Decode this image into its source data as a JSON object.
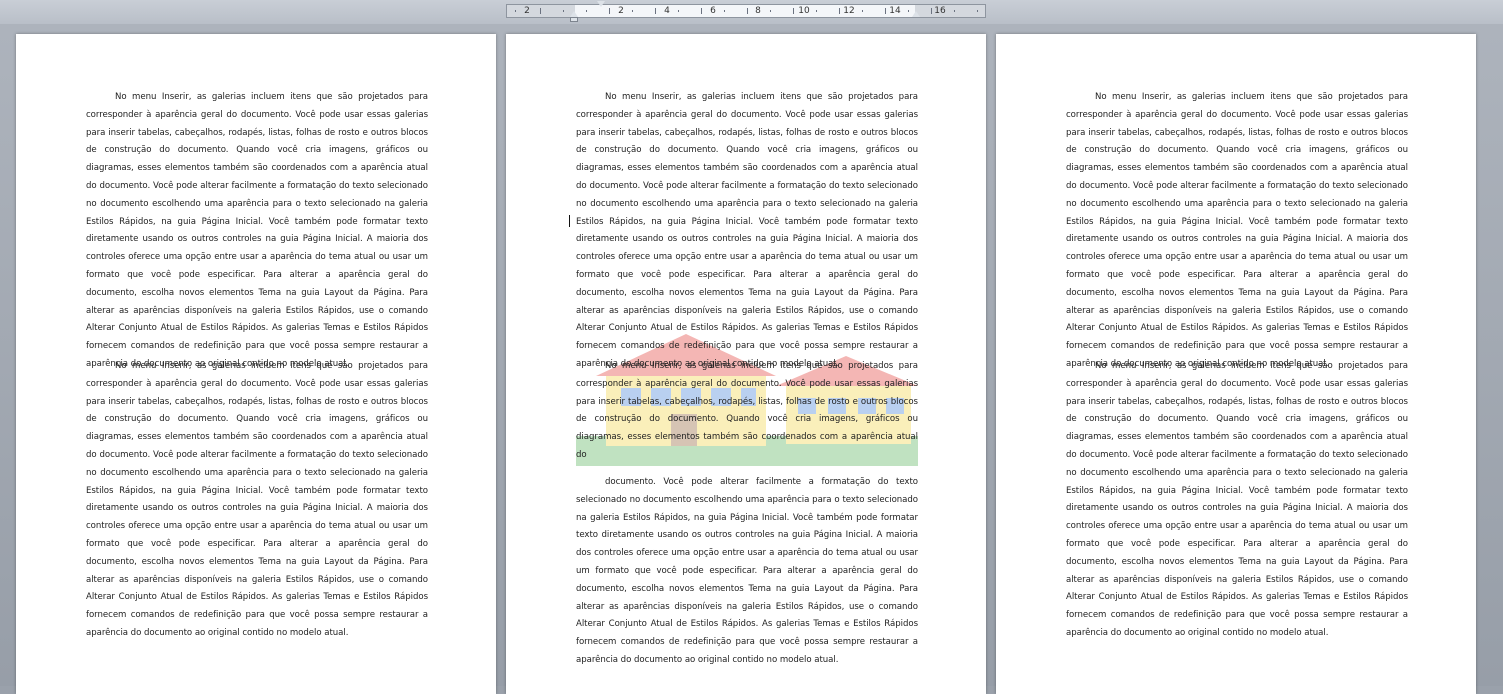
{
  "ruler": {
    "labels": [
      "2",
      "2",
      "4",
      "6",
      "8",
      "10",
      "12",
      "14",
      "16"
    ]
  },
  "document": {
    "paragraph_full": "No menu Inserir, as galerias incluem itens que são projetados para corresponder à aparência geral do documento. Você pode usar essas galerias para inserir tabelas, cabeçalhos, rodapés, listas, folhas de rosto e outros blocos de construção do documento. Quando você cria imagens, gráficos ou diagramas, esses elementos também são coordenados com a aparência atual do documento. Você pode alterar facilmente a formatação do texto selecionado no documento escolhendo uma aparência para o texto selecionado na galeria Estilos Rápidos, na guia Página Inicial. Você também pode formatar texto diretamente usando os outros controles na guia Página Inicial. A maioria dos controles oferece uma opção entre usar a aparência do tema atual ou usar um formato que você pode especificar. Para alterar a aparência geral do documento, escolha novos elementos Tema na guia Layout da Página. Para alterar as aparências disponíveis na galeria Estilos Rápidos, use o comando Alterar Conjunto Atual de Estilos Rápidos. As galerias Temas e Estilos Rápidos fornecem comandos de redefinição para que você possa sempre restaurar a aparência do documento ao original contido no modelo atual.",
    "paragraph_part1": "No menu Inserir, as galerias incluem itens que são projetados para corresponder à aparência geral do documento. Você pode usar essas galerias para inserir tabelas, cabeçalhos, rodapés, listas, folhas de rosto e outros blocos de construção do documento. Quando você cria imagens, gráficos ou diagramas, esses elementos também são coordenados com a aparência atual do",
    "paragraph_part2": "documento. Você pode alterar facilmente a formatação do texto selecionado no documento escolhendo uma aparência para o texto selecionado na galeria Estilos Rápidos, na guia Página Inicial. Você também pode formatar texto diretamente usando os outros controles na guia Página Inicial. A maioria dos controles oferece uma opção entre usar a aparência do tema atual ou usar um formato que você pode especificar. Para alterar a aparência geral do documento, escolha novos elementos Tema na guia Layout da Página. Para alterar as aparências disponíveis na galeria Estilos Rápidos, use o comando Alterar Conjunto Atual de Estilos Rápidos. As galerias Temas e Estilos Rápidos fornecem comandos de redefinição para que você possa sempre restaurar a aparência do documento ao original contido no modelo atual."
  },
  "colors": {
    "workspace": "#9aa1ab",
    "page": "#ffffff",
    "text": "#222222",
    "watermark_roof": "#e0302a",
    "watermark_wall": "#f2d33c",
    "watermark_window": "#3a7bd5",
    "watermark_grass": "#4caf50"
  },
  "watermark": {
    "icon": "house-school-icon"
  }
}
